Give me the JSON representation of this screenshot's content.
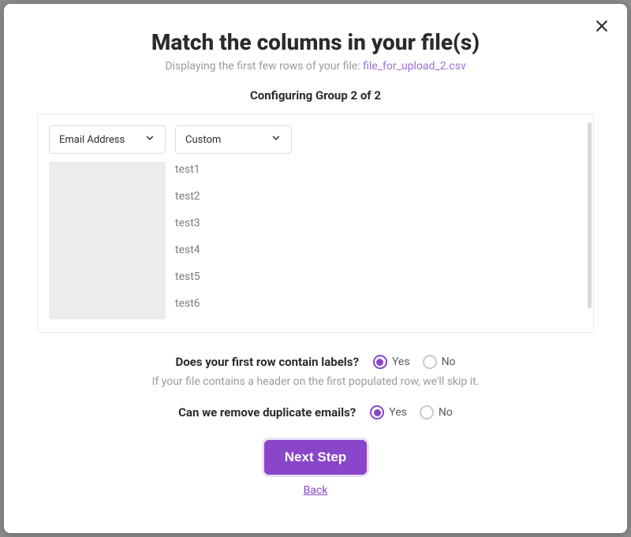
{
  "title": "Match the columns in your file(s)",
  "subtitle_prefix": "Displaying the first few rows of your file: ",
  "file_name": "file_for_upload_2.csv",
  "group_label": "Configuring Group 2 of 2",
  "dropdowns": {
    "col1": "Email Address",
    "col2": "Custom"
  },
  "preview_rows_col2": [
    "test1",
    "test2",
    "test3",
    "test4",
    "test5",
    "test6"
  ],
  "question_labels": {
    "label": "Does your first row contain labels?",
    "helper": "If your file contains a header on the first populated row, we'll skip it.",
    "yes": "Yes",
    "no": "No",
    "selected": "yes"
  },
  "question_duplicates": {
    "label": "Can we remove duplicate emails?",
    "yes": "Yes",
    "no": "No",
    "selected": "yes"
  },
  "buttons": {
    "next": "Next Step",
    "back": "Back"
  }
}
